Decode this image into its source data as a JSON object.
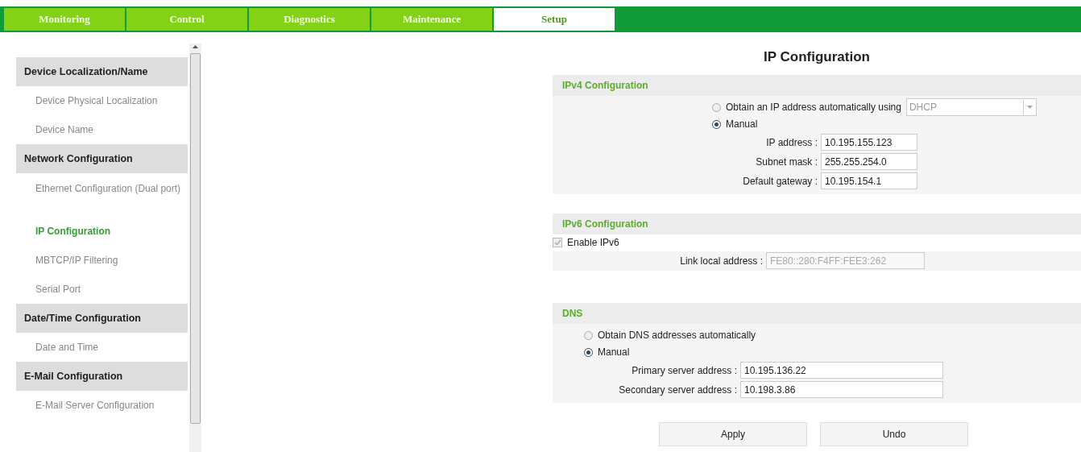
{
  "tabs": [
    {
      "label": "Monitoring",
      "selected": false
    },
    {
      "label": "Control",
      "selected": false
    },
    {
      "label": "Diagnostics",
      "selected": false
    },
    {
      "label": "Maintenance",
      "selected": false
    },
    {
      "label": "Setup",
      "selected": true
    }
  ],
  "sidebar": [
    {
      "title": "Device Localization/Name",
      "items": [
        {
          "label": "Device Physical Localization",
          "selected": false
        },
        {
          "label": "Device Name",
          "selected": false
        }
      ]
    },
    {
      "title": "Network Configuration",
      "items": [
        {
          "label": "Ethernet Configuration (Dual port)",
          "selected": false
        },
        {
          "label": "IP Configuration",
          "selected": true
        },
        {
          "label": "MBTCP/IP Filtering",
          "selected": false
        },
        {
          "label": "Serial Port",
          "selected": false
        }
      ]
    },
    {
      "title": "Date/Time Configuration",
      "items": [
        {
          "label": "Date and Time",
          "selected": false
        }
      ]
    },
    {
      "title": "E-Mail Configuration",
      "items": [
        {
          "label": "E-Mail Server Configuration",
          "selected": false
        }
      ]
    }
  ],
  "page_title": "IP Configuration",
  "ipv4": {
    "title": "IPv4 Configuration",
    "options": [
      {
        "label": "Obtain an IP address automatically using",
        "selected": false,
        "dropdown": {
          "value": "DHCP",
          "disabled": true
        }
      },
      {
        "label": "Manual",
        "selected": true
      }
    ],
    "fields": [
      {
        "label": "IP address :",
        "value": "10.195.155.123",
        "disabled": false
      },
      {
        "label": "Subnet mask :",
        "value": "255.255.254.0",
        "disabled": false
      },
      {
        "label": "Default gateway :",
        "value": "10.195.154.1",
        "disabled": false
      }
    ]
  },
  "ipv6": {
    "title": "IPv6 Configuration",
    "enable": {
      "label": "Enable IPv6",
      "checked": true,
      "disabled": true
    },
    "fields": [
      {
        "label": "Link local address :",
        "value": "FE80::280:F4FF:FEE3:262",
        "disabled": true
      }
    ]
  },
  "dns": {
    "title": "DNS",
    "options": [
      {
        "label": "Obtain DNS addresses automatically",
        "selected": false
      },
      {
        "label": "Manual",
        "selected": true
      }
    ],
    "fields": [
      {
        "label": "Primary server address :",
        "value": "10.195.136.22",
        "disabled": false
      },
      {
        "label": "Secondary server address :",
        "value": "10.198.3.86",
        "disabled": false
      }
    ]
  },
  "buttons": [
    "Apply",
    "Undo"
  ]
}
